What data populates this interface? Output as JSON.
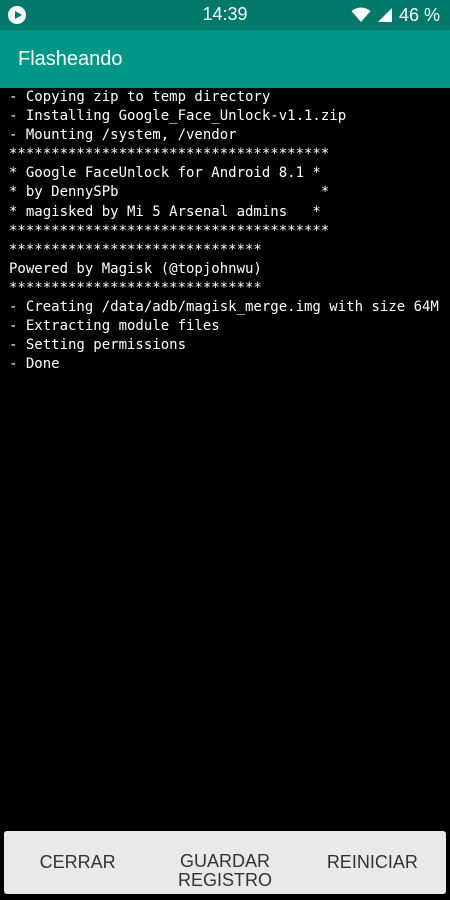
{
  "status_bar": {
    "time": "14:39",
    "battery": "46 %",
    "icons": [
      "play-circle-icon",
      "wifi-icon",
      "cellular-signal-icon"
    ]
  },
  "toolbar": {
    "title": "Flasheando"
  },
  "console": {
    "lines": [
      "- Copying zip to temp directory",
      "- Installing Google_Face_Unlock-v1.1.zip",
      "- Mounting /system, /vendor",
      "**************************************",
      "* Google FaceUnlock for Android 8.1 *",
      "* by DennySPb                        *",
      "* magisked by Mi 5 Arsenal admins   *",
      "**************************************",
      "******************************",
      "Powered by Magisk (@topjohnwu)",
      "******************************",
      "- Creating /data/adb/magisk_merge.img with size 64M",
      "- Extracting module files",
      "- Setting permissions",
      "- Done"
    ]
  },
  "footer": {
    "close_label": "CERRAR",
    "save_log_label": "GUARDAR REGISTRO",
    "reboot_label": "REINICIAR"
  },
  "colors": {
    "status_bar": "#00796b",
    "toolbar": "#009688",
    "console_bg": "#000000",
    "console_text": "#ffffff",
    "footer_bg": "#e9e9e9"
  }
}
